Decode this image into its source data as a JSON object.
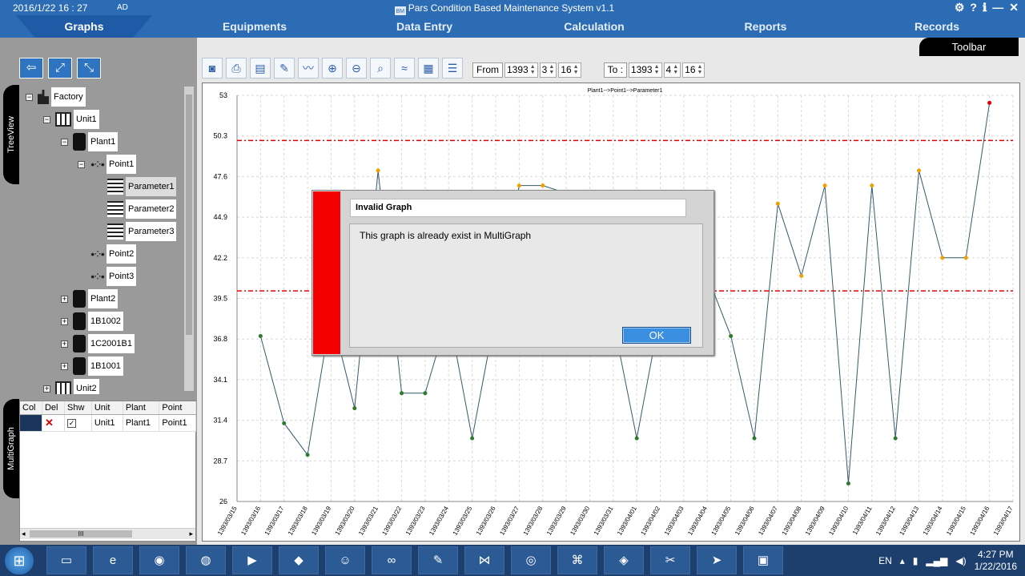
{
  "titlebar": {
    "datetime": "2016/1/22   16 : 27",
    "ad": "AD",
    "app_title": "Pars Condition Based Maintenance System v1.1",
    "logo": "BM",
    "controls": [
      "gear-icon",
      "help-icon",
      "info-icon",
      "minimize-icon",
      "close-icon"
    ],
    "control_glyphs": [
      "⚙",
      "?",
      "ℹ",
      "—",
      "✕"
    ]
  },
  "tabs": [
    {
      "label": "Graphs",
      "active": true
    },
    {
      "label": "Equipments",
      "active": false
    },
    {
      "label": "Data Entry",
      "active": false
    },
    {
      "label": "Calculation",
      "active": false
    },
    {
      "label": "Reports",
      "active": false
    },
    {
      "label": "Records",
      "active": false
    }
  ],
  "toolbar_label": "Toolbar",
  "nav_tools": [
    "back-icon",
    "expand-icon",
    "collapse-icon"
  ],
  "treeview": {
    "label": "TreeView",
    "nodes": [
      {
        "label": "Factory",
        "icon": "factory-icon",
        "expander": "−",
        "selected": false
      },
      {
        "label": "Unit1",
        "icon": "unit-icon",
        "expander": "−",
        "selected": false
      },
      {
        "label": "Plant1",
        "icon": "plant-icon",
        "expander": "−",
        "selected": false
      },
      {
        "label": "Point1",
        "icon": "point-icon",
        "expander": "−",
        "selected": false
      },
      {
        "label": "Parameter1",
        "icon": "parameter-icon",
        "expander": "",
        "selected": true
      },
      {
        "label": "Parameter2",
        "icon": "parameter-icon",
        "expander": "",
        "selected": false
      },
      {
        "label": "Parameter3",
        "icon": "parameter-icon",
        "expander": "",
        "selected": false
      },
      {
        "label": "Point2",
        "icon": "point-icon",
        "expander": "",
        "selected": false
      },
      {
        "label": "Point3",
        "icon": "point-icon",
        "expander": "",
        "selected": false
      },
      {
        "label": "Plant2",
        "icon": "plant-icon",
        "expander": "+",
        "selected": false
      },
      {
        "label": "1B1002",
        "icon": "plant-icon",
        "expander": "+",
        "selected": false
      },
      {
        "label": "1C2001B1",
        "icon": "plant-icon",
        "expander": "+",
        "selected": false
      },
      {
        "label": "1B1001",
        "icon": "plant-icon",
        "expander": "+",
        "selected": false
      },
      {
        "label": "Unit2",
        "icon": "unit-icon",
        "expander": "+",
        "selected": false
      }
    ]
  },
  "multigraph": {
    "label": "MultiGraph",
    "columns": [
      "Col",
      "Del",
      "Shw",
      "Unit",
      "Plant",
      "Point"
    ],
    "rows": [
      {
        "color": "#1b365d",
        "unit": "Unit1",
        "plant": "Plant1",
        "point": "Point1",
        "shown": true
      }
    ],
    "scroll_thumb": "III"
  },
  "graph_tools": [
    "camera-icon",
    "print-icon",
    "pdf-icon",
    "edit-icon",
    "chart-icon",
    "zoom-in-icon",
    "zoom-out-icon",
    "zoom-icon",
    "wave-icon",
    "grid-icon",
    "list-icon"
  ],
  "range": {
    "from_label": "From",
    "from_year": "1393",
    "from_month": "3",
    "from_day": "16",
    "to_label": "To :",
    "to_year": "1393",
    "to_month": "4",
    "to_day": "16"
  },
  "dialog": {
    "title": "Invalid Graph",
    "message": "This graph is already exist in MultiGraph",
    "ok_label": "OK"
  },
  "taskbar": {
    "apps": [
      "explorer",
      "internet-explorer",
      "chrome",
      "firefox",
      "app",
      "box",
      "game",
      "link",
      "notepad",
      "visual-studio",
      "browser",
      "devexpress",
      "git",
      "tools",
      "telegram",
      "cbm-app"
    ],
    "language": "EN",
    "time": "4:27 PM",
    "date": "1/22/2016"
  },
  "chart_data": {
    "type": "line",
    "title": "Plant1-->Point1-->Parameter1",
    "x": [
      "1393/03/15",
      "1393/03/16",
      "1393/03/17",
      "1393/03/18",
      "1393/03/19",
      "1393/03/20",
      "1393/03/21",
      "1393/03/22",
      "1393/03/23",
      "1393/03/24",
      "1393/03/25",
      "1393/03/26",
      "1393/03/27",
      "1393/03/28",
      "1393/03/29",
      "1393/03/30",
      "1393/03/31",
      "1393/04/01",
      "1393/04/02",
      "1393/04/03",
      "1393/04/04",
      "1393/04/05",
      "1393/04/06",
      "1393/04/07",
      "1393/04/08",
      "1393/04/09",
      "1393/04/10",
      "1393/04/11",
      "1393/04/12",
      "1393/04/13",
      "1393/04/14",
      "1393/04/15",
      "1393/04/16",
      "1393/04/17"
    ],
    "series": [
      {
        "values": [
          null,
          37,
          31.2,
          29.1,
          38.5,
          32.2,
          48,
          33.2,
          33.2,
          38.5,
          30.2,
          38.5,
          47,
          47,
          46.5,
          46.5,
          38,
          30.2,
          38.5,
          38.5,
          41,
          37,
          30.2,
          45.8,
          41,
          47,
          27.2,
          47,
          30.2,
          48,
          42.2,
          42.2,
          52.5,
          null
        ],
        "color": "#355a6b"
      }
    ],
    "ylim": [
      26,
      53
    ],
    "yticks": [
      26,
      28.7,
      31.4,
      34.1,
      36.8,
      39.5,
      42.2,
      44.9,
      47.6,
      50.3,
      53
    ],
    "thresholds": [
      50,
      40
    ],
    "threshold_color": "#e00000",
    "point_colors": {
      "normal": "#2e7a2e",
      "warning": "#f0a000",
      "alarm": "#e00000"
    },
    "grid": true
  }
}
